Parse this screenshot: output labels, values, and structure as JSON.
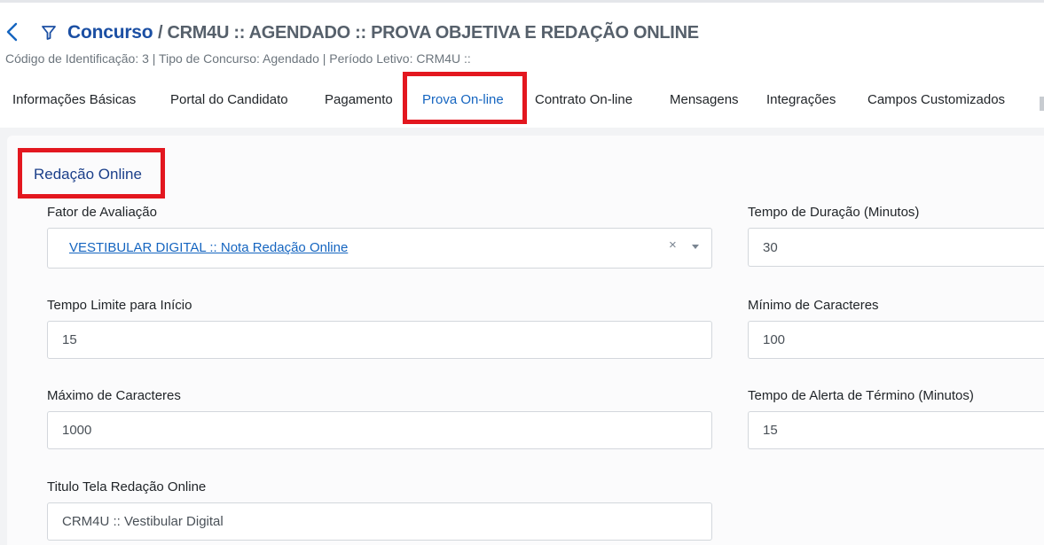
{
  "header": {
    "title": "Concurso",
    "breadcrumb": "/ CRM4U :: AGENDADO :: PROVA OBJETIVA E REDAÇÃO ONLINE",
    "subtitle": "Código de Identificação: 3 | Tipo de Concurso: Agendado | Período Letivo: CRM4U ::",
    "icons": [
      "chevron-left-icon",
      "filter-icon"
    ],
    "accent_color": "#1b4fa3"
  },
  "tabs": [
    {
      "label": "Informações Básicas",
      "active": false
    },
    {
      "label": "Portal do Candidato",
      "active": false
    },
    {
      "label": "Pagamento",
      "active": false
    },
    {
      "label": "Prova On-line",
      "active": true
    },
    {
      "label": "Contrato On-line",
      "active": false
    },
    {
      "label": "Mensagens",
      "active": false
    },
    {
      "label": "Integrações",
      "active": false
    },
    {
      "label": "Campos Customizados",
      "active": false
    }
  ],
  "highlight_color": "#e3171f",
  "section": {
    "title": "Redação Online"
  },
  "form": {
    "fator_avaliacao": {
      "label": "Fator de Avaliação",
      "value": "VESTIBULAR DIGITAL :: Nota Redação Online",
      "clear_symbol": "×"
    },
    "tempo_duracao": {
      "label": "Tempo de Duração (Minutos)",
      "value": "30"
    },
    "tempo_limite": {
      "label": "Tempo Limite para Início",
      "value": "15"
    },
    "minimo_caracteres": {
      "label": "Mínimo de Caracteres",
      "value": "100"
    },
    "maximo_caracteres": {
      "label": "Máximo de Caracteres",
      "value": "1000"
    },
    "tempo_alerta": {
      "label": "Tempo de Alerta de Término (Minutos)",
      "value": "15"
    },
    "titulo_tela": {
      "label": "Titulo Tela Redação Online",
      "value": "CRM4U :: Vestibular Digital"
    }
  }
}
